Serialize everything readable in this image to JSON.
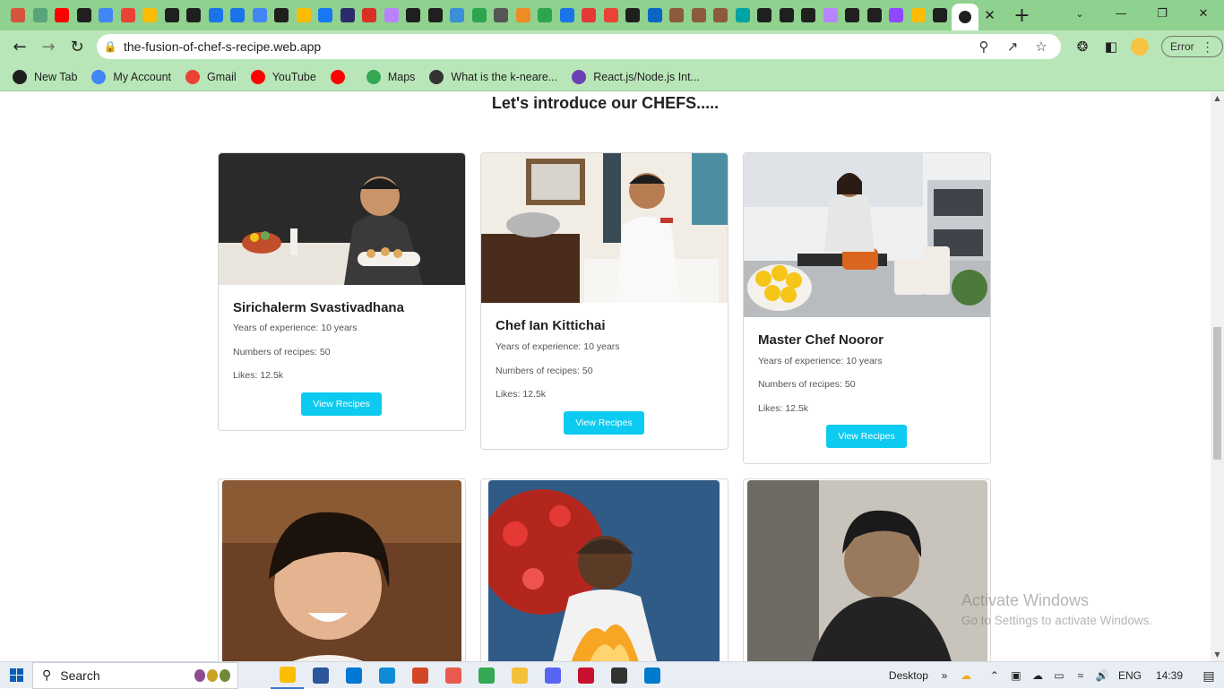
{
  "browser": {
    "tab_favicons": [
      {
        "name": "instagram-icon",
        "color": "#d6543d"
      },
      {
        "name": "openai-icon",
        "color": "#59a47a"
      },
      {
        "name": "youtube-icon",
        "color": "#ff0000"
      },
      {
        "name": "github-icon",
        "color": "#1f1f1f"
      },
      {
        "name": "google-icon",
        "color": "#4285f4"
      },
      {
        "name": "gmail-icon",
        "color": "#ea4335"
      },
      {
        "name": "google-drive-icon",
        "color": "#fbbc04"
      },
      {
        "name": "codeforces-icon",
        "color": "#1f1f1f"
      },
      {
        "name": "globe-icon",
        "color": "#1f1f1f"
      },
      {
        "name": "imgbb-icon",
        "color": "#1a73e8"
      },
      {
        "name": "imgbb-icon",
        "color": "#1a73e8"
      },
      {
        "name": "google-icon",
        "color": "#4285f4"
      },
      {
        "name": "codeforces-icon",
        "color": "#1f1f1f"
      },
      {
        "name": "google-drive-icon",
        "color": "#fbbc04"
      },
      {
        "name": "facebook-icon",
        "color": "#1877f2"
      },
      {
        "name": "dev-icon",
        "color": "#2b2b6b"
      },
      {
        "name": "notion-icon",
        "color": "#d93025"
      },
      {
        "name": "vite-icon",
        "color": "#b983ff"
      },
      {
        "name": "github-icon",
        "color": "#1f1f1f"
      },
      {
        "name": "github-icon",
        "color": "#1f1f1f"
      },
      {
        "name": "docs-icon",
        "color": "#3b8fd9"
      },
      {
        "name": "leetcode-icon",
        "color": "#2da44e"
      },
      {
        "name": "wikipedia-icon",
        "color": "#555555"
      },
      {
        "name": "flower-icon",
        "color": "#f08a24"
      },
      {
        "name": "leetcode-icon",
        "color": "#2da44e"
      },
      {
        "name": "is-icon",
        "color": "#1a73e8"
      },
      {
        "name": "record-icon",
        "color": "#e53935"
      },
      {
        "name": "gmail-icon",
        "color": "#ea4335"
      },
      {
        "name": "github-icon",
        "color": "#1f1f1f"
      },
      {
        "name": "linkedin-icon",
        "color": "#0a66c2"
      },
      {
        "name": "gallery-icon",
        "color": "#8d5a3b"
      },
      {
        "name": "gallery-icon",
        "color": "#8d5a3b"
      },
      {
        "name": "gallery-icon",
        "color": "#8d5a3b"
      },
      {
        "name": "diamond-icon",
        "color": "#00a3a3"
      },
      {
        "name": "github-icon",
        "color": "#1f1f1f"
      },
      {
        "name": "github-icon",
        "color": "#1f1f1f"
      },
      {
        "name": "github-icon",
        "color": "#1f1f1f"
      },
      {
        "name": "vite-icon",
        "color": "#b983ff"
      },
      {
        "name": "github-icon",
        "color": "#1f1f1f"
      },
      {
        "name": "github-icon",
        "color": "#1f1f1f"
      },
      {
        "name": "twitch-icon",
        "color": "#9146ff"
      },
      {
        "name": "google-drive-icon",
        "color": "#fbbc04"
      },
      {
        "name": "github-icon",
        "color": "#1f1f1f"
      }
    ],
    "url": "the-fusion-of-chef-s-recipe.web.app",
    "profile_status": "Error",
    "bookmarks": [
      {
        "label": "New Tab",
        "icon": "globe-icon",
        "color": "#1f1f1f"
      },
      {
        "label": "My Account",
        "icon": "google-icon",
        "color": "#4285f4"
      },
      {
        "label": "Gmail",
        "icon": "gmail-icon",
        "color": "#ea4335"
      },
      {
        "label": "YouTube",
        "icon": "youtube-icon",
        "color": "#ff0000"
      },
      {
        "label": "",
        "icon": "youtube-icon",
        "color": "#ff0000"
      },
      {
        "label": "Maps",
        "icon": "maps-pin-icon",
        "color": "#34a853"
      },
      {
        "label": "What is the k-neare...",
        "icon": "ai-icon",
        "color": "#333333"
      },
      {
        "label": "React.js/Node.js Int...",
        "icon": "grid-icon",
        "color": "#6b3fb6"
      }
    ]
  },
  "page": {
    "section_title": "Let's introduce our CHEFS.....",
    "cards": [
      {
        "name": "Sirichalerm Svastivadhana",
        "experience": "Years of experience: 10 years",
        "recipes": "Numbers of recipes: 50",
        "likes": "Likes: 12.5k",
        "button": "View Recipes",
        "photo": "chef-photo-1"
      },
      {
        "name": "Chef Ian Kittichai",
        "experience": "Years of experience: 10 years",
        "recipes": "Numbers of recipes: 50",
        "likes": "Likes: 12.5k",
        "button": "View Recipes",
        "photo": "chef-photo-2"
      },
      {
        "name": "Master Chef Nooror",
        "experience": "Years of experience: 10 years",
        "recipes": "Numbers of recipes: 50",
        "likes": "Likes: 12.5k",
        "button": "View Recipes",
        "photo": "chef-photo-3"
      },
      {
        "photo": "chef-photo-4"
      },
      {
        "photo": "chef-photo-5"
      },
      {
        "photo": "chef-photo-6"
      }
    ],
    "accent_color": "#0dcaf0"
  },
  "watermark": {
    "line1": "Activate Windows",
    "line2": "Go to Settings to activate Windows."
  },
  "taskbar": {
    "search_label": "Search",
    "desktop_label": "Desktop",
    "language": "ENG",
    "time": "14:39",
    "apps": [
      {
        "name": "chrome-icon",
        "color": "#fbbc04"
      },
      {
        "name": "word-icon",
        "color": "#2b579a"
      },
      {
        "name": "mail-icon",
        "color": "#0078d4"
      },
      {
        "name": "edge-icon",
        "color": "#0f8bd6"
      },
      {
        "name": "powerpoint-icon",
        "color": "#d24726"
      },
      {
        "name": "snip-icon",
        "color": "#e85a4f"
      },
      {
        "name": "store-icon",
        "color": "#34a853"
      },
      {
        "name": "folder-icon",
        "color": "#f3c13a"
      },
      {
        "name": "discord-icon",
        "color": "#5865f2"
      },
      {
        "name": "mcafee-icon",
        "color": "#c8102e"
      },
      {
        "name": "terminal-icon",
        "color": "#333333"
      },
      {
        "name": "vscode-icon",
        "color": "#007acc"
      }
    ]
  }
}
